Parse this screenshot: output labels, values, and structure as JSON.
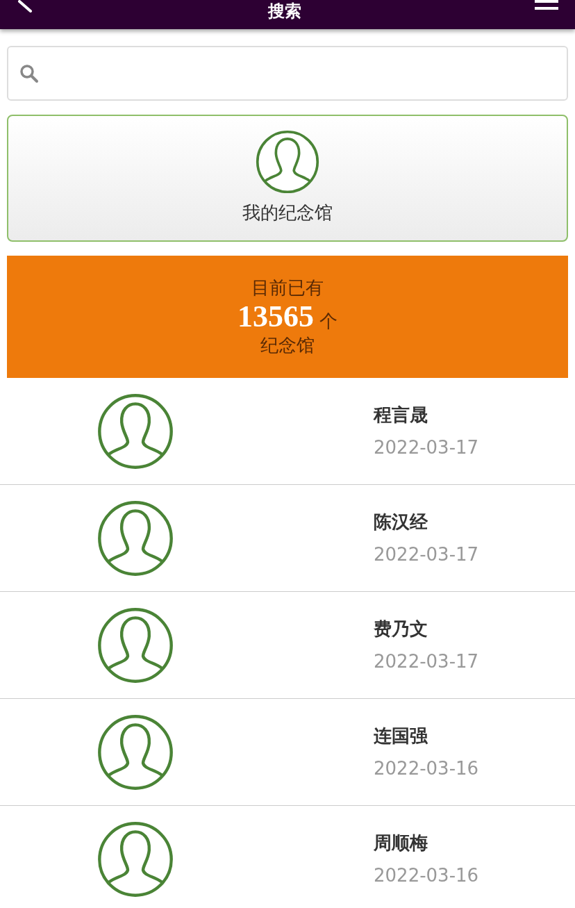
{
  "header": {
    "title": "搜索"
  },
  "my_memorial": {
    "label": "我的纪念馆"
  },
  "banner": {
    "line_1": "目前已有",
    "count": "13565",
    "unit": "个",
    "line_3": "纪念馆"
  },
  "memorials": [
    {
      "name": "程言晟",
      "date": "2022-03-17"
    },
    {
      "name": "陈汉经",
      "date": "2022-03-17"
    },
    {
      "name": "费乃文",
      "date": "2022-03-17"
    },
    {
      "name": "连国强",
      "date": "2022-03-16"
    },
    {
      "name": "周顺梅",
      "date": "2022-03-16"
    }
  ]
}
